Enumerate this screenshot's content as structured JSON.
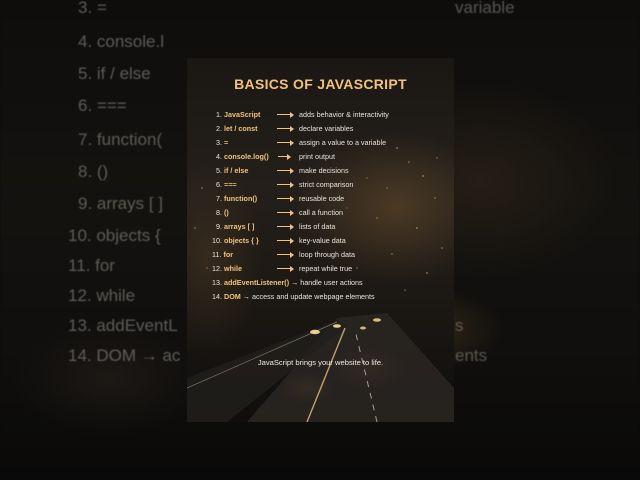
{
  "card": {
    "title": "BASICS OF JAVASCRIPT",
    "footer": "JavaScript brings your website to life.",
    "items": [
      {
        "n": "1.",
        "term": "JavaScript",
        "desc": "adds behavior & interactivity"
      },
      {
        "n": "2.",
        "term": "let / const",
        "desc": "declare variables"
      },
      {
        "n": "3.",
        "term": "=",
        "desc": "assign a value to a variable"
      },
      {
        "n": "4.",
        "term": "console.log()",
        "desc": "print output"
      },
      {
        "n": "5.",
        "term": "if / else",
        "desc": "make decisions"
      },
      {
        "n": "6.",
        "term": "===",
        "desc": "strict comparison"
      },
      {
        "n": "7.",
        "term": "function()",
        "desc": "reusable code"
      },
      {
        "n": "8.",
        "term": "()",
        "desc": "call a function"
      },
      {
        "n": "9.",
        "term": "arrays [ ]",
        "desc": "lists of data"
      },
      {
        "n": "10.",
        "term": "objects { }",
        "desc": "key-value data"
      },
      {
        "n": "11.",
        "term": "for",
        "desc": "loop through data"
      },
      {
        "n": "12.",
        "term": "while",
        "desc": "repeat while true"
      },
      {
        "n": "13.",
        "term": "addEventListener()",
        "desc": "→ handle user actions"
      },
      {
        "n": "14.",
        "term": "DOM",
        "desc": "→ access and update webpage elements"
      }
    ]
  },
  "background": {
    "lines": [
      {
        "text": "3. ="
      },
      {
        "text": "4. console.l"
      },
      {
        "text": "5. if / else"
      },
      {
        "text": "6. ==="
      },
      {
        "text": "7. function("
      },
      {
        "text": "8. ()"
      },
      {
        "text": "9. arrays [ ]"
      },
      {
        "text": "10. objects {"
      },
      {
        "text": "11. for"
      },
      {
        "text": "12. while"
      },
      {
        "text": "13. addEventL"
      },
      {
        "text": "14. DOM → ac"
      }
    ],
    "right_fragments": [
      {
        "text": "variable"
      },
      {
        "text": "s"
      },
      {
        "text": "ents"
      }
    ]
  },
  "colors": {
    "accent": "#f2c27a",
    "text": "#e9e4dc"
  }
}
